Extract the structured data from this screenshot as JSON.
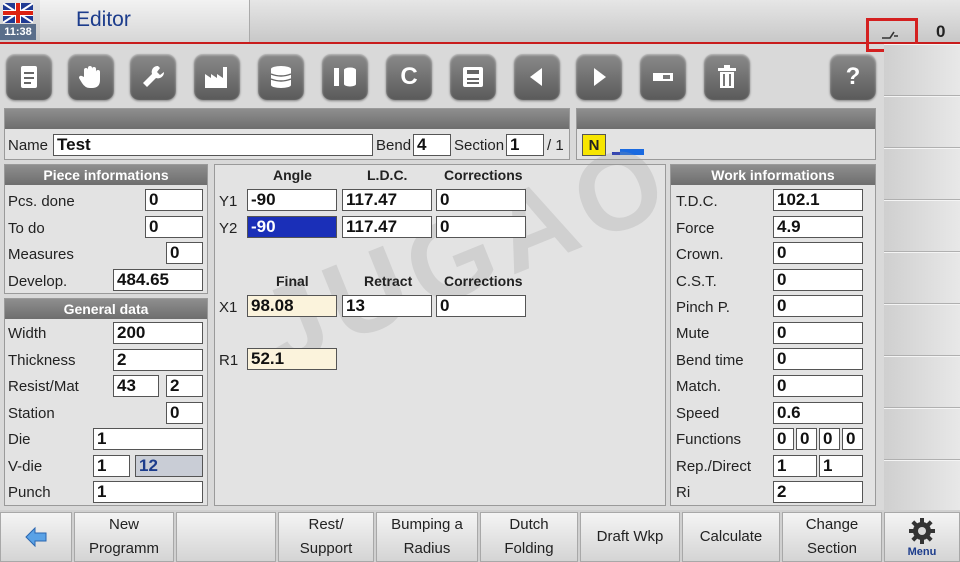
{
  "header": {
    "time": "11:38",
    "title": "Editor",
    "status_count": "0"
  },
  "name_row": {
    "name_label": "Name",
    "name_value": "Test",
    "bend_label": "Bend",
    "bend_value": "4",
    "section_label": "Section",
    "section_value": "1",
    "section_total": "/ 1",
    "badge": "N"
  },
  "piece": {
    "title": "Piece informations",
    "pcs_done_label": "Pcs. done",
    "pcs_done": "0",
    "to_do_label": "To do",
    "to_do": "0",
    "measures_label": "Measures",
    "measures": "0",
    "develop_label": "Develop.",
    "develop": "484.65"
  },
  "general": {
    "title": "General data",
    "width_label": "Width",
    "width": "200",
    "thickness_label": "Thickness",
    "thickness": "2",
    "resist_label": "Resist/Mat",
    "resist": "43",
    "mat": "2",
    "station_label": "Station",
    "station": "0",
    "die_label": "Die",
    "die": "1",
    "vdie_label": "V-die",
    "vdie_a": "1",
    "vdie_b": "12",
    "punch_label": "Punch",
    "punch": "1"
  },
  "center": {
    "col_angle": "Angle",
    "col_ldc": "L.D.C.",
    "col_corr": "Corrections",
    "y1_label": "Y1",
    "y1_angle": "-90",
    "y1_ldc": "117.47",
    "y1_corr": "0",
    "y2_label": "Y2",
    "y2_angle": "-90",
    "y2_ldc": "117.47",
    "y2_corr": "0",
    "col_final": "Final",
    "col_retract": "Retract",
    "col_corr2": "Corrections",
    "x1_label": "X1",
    "x1_final": "98.08",
    "x1_retract": "13",
    "x1_corr": "0",
    "r1_label": "R1",
    "r1_value": "52.1"
  },
  "work": {
    "title": "Work informations",
    "tdc_label": "T.D.C.",
    "tdc": "102.1",
    "force_label": "Force",
    "force": "4.9",
    "crown_label": "Crown.",
    "crown": "0",
    "cst_label": "C.S.T.",
    "cst": "0",
    "pinch_label": "Pinch P.",
    "pinch": "0",
    "mute_label": "Mute",
    "mute": "0",
    "bendtime_label": "Bend time",
    "bendtime": "0",
    "match_label": "Match.",
    "match": "0",
    "speed_label": "Speed",
    "speed": "0.6",
    "functions_label": "Functions",
    "fn1": "0",
    "fn2": "0",
    "fn3": "0",
    "fn4": "0",
    "rep_label": "Rep./Direct",
    "rep1": "1",
    "rep2": "1",
    "ri_label": "Ri",
    "ri": "2"
  },
  "bottom": {
    "new_program": [
      "New",
      "Programm"
    ],
    "rest_support": [
      "Rest/",
      "Support"
    ],
    "bumping": [
      "Bumping a",
      "Radius"
    ],
    "dutch": [
      "Dutch",
      "Folding"
    ],
    "draft": "Draft Wkp",
    "calculate": "Calculate",
    "change_section": [
      "Change",
      "Section"
    ],
    "menu": "Menu"
  },
  "toolbar": {
    "clear_label": "C",
    "help_label": "?"
  },
  "watermark": "JUGAO"
}
